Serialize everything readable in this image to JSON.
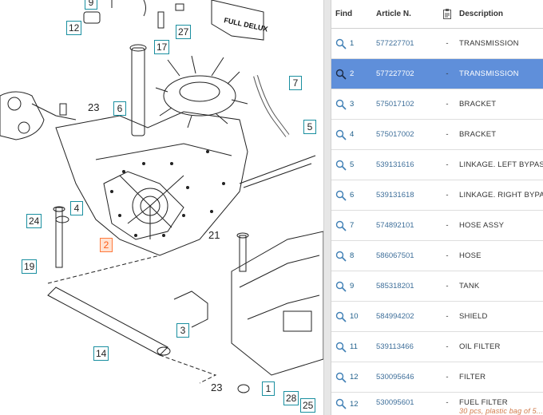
{
  "table": {
    "headers": {
      "find": "Find",
      "article": "Article N.",
      "description": "Description"
    },
    "rows": [
      {
        "find": "1",
        "article": "577227701",
        "dash": "-",
        "description": "TRANSMISSION",
        "selected": false
      },
      {
        "find": "2",
        "article": "577227702",
        "dash": "-",
        "description": "TRANSMISSION",
        "selected": true
      },
      {
        "find": "3",
        "article": "575017102",
        "dash": "-",
        "description": "BRACKET",
        "selected": false
      },
      {
        "find": "4",
        "article": "575017002",
        "dash": "-",
        "description": "BRACKET",
        "selected": false
      },
      {
        "find": "5",
        "article": "539131616",
        "dash": "-",
        "description": "LINKAGE. LEFT BYPASS",
        "selected": false
      },
      {
        "find": "6",
        "article": "539131618",
        "dash": "-",
        "description": "LINKAGE. RIGHT BYPASS",
        "selected": false
      },
      {
        "find": "7",
        "article": "574892101",
        "dash": "-",
        "description": "HOSE ASSY",
        "selected": false
      },
      {
        "find": "8",
        "article": "586067501",
        "dash": "-",
        "description": "HOSE",
        "selected": false
      },
      {
        "find": "9",
        "article": "585318201",
        "dash": "-",
        "description": "TANK",
        "selected": false
      },
      {
        "find": "10",
        "article": "584994202",
        "dash": "-",
        "description": "SHIELD",
        "selected": false
      },
      {
        "find": "11",
        "article": "539113466",
        "dash": "-",
        "description": "OIL FILTER",
        "selected": false
      },
      {
        "find": "12",
        "article": "530095646",
        "dash": "-",
        "description": "FILTER",
        "selected": false
      },
      {
        "find": "12",
        "article": "530095601",
        "dash": "-",
        "description": "FUEL FILTER",
        "note": "30 pcs, plastic bag of 5...",
        "selected": false
      }
    ]
  },
  "diagram": {
    "callouts": {
      "c12": "12",
      "c17": "17",
      "c27": "27",
      "c7": "7",
      "c5": "5",
      "c6": "6",
      "c24": "24",
      "c4": "4",
      "c2": "2",
      "c19": "19",
      "c3": "3",
      "c14": "14",
      "c1": "1",
      "c28": "28",
      "c25": "25",
      "top": "9"
    },
    "labels": {
      "n23a": "23",
      "n21": "21",
      "n23b": "23"
    },
    "brand_text": "FULL DELUX"
  },
  "colors": {
    "selected_row": "#5f8fda",
    "callout_border": "#1a8fa0",
    "selected_callout": "#ff7a3c"
  }
}
